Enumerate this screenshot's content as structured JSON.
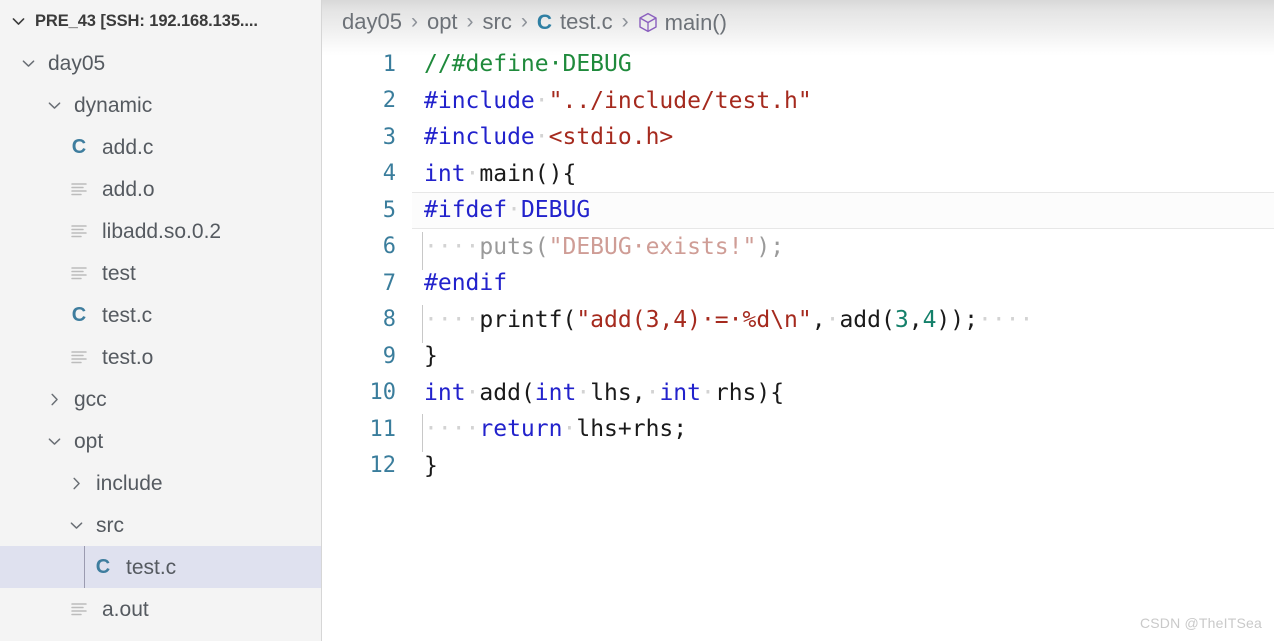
{
  "sidebar": {
    "header": {
      "label": "PRE_43 [SSH: 192.168.135....",
      "chevron": "chevron-down-icon"
    },
    "items": [
      {
        "label": "day05",
        "depth": 1,
        "kind": "folder",
        "state": "expanded",
        "icon": "chevron-down-icon",
        "selected": false
      },
      {
        "label": "dynamic",
        "depth": 2,
        "kind": "folder",
        "state": "expanded",
        "icon": "chevron-down-icon",
        "selected": false
      },
      {
        "label": "add.c",
        "depth": 3,
        "kind": "c-file",
        "state": "",
        "icon": "c-file-icon",
        "selected": false
      },
      {
        "label": "add.o",
        "depth": 3,
        "kind": "file",
        "state": "",
        "icon": "generic-file-icon",
        "selected": false
      },
      {
        "label": "libadd.so.0.2",
        "depth": 3,
        "kind": "file",
        "state": "",
        "icon": "generic-file-icon",
        "selected": false
      },
      {
        "label": "test",
        "depth": 3,
        "kind": "file",
        "state": "",
        "icon": "generic-file-icon",
        "selected": false
      },
      {
        "label": "test.c",
        "depth": 3,
        "kind": "c-file",
        "state": "",
        "icon": "c-file-icon",
        "selected": false
      },
      {
        "label": "test.o",
        "depth": 3,
        "kind": "file",
        "state": "",
        "icon": "generic-file-icon",
        "selected": false
      },
      {
        "label": "gcc",
        "depth": 2,
        "kind": "folder",
        "state": "collapsed",
        "icon": "chevron-right-icon",
        "selected": false
      },
      {
        "label": "opt",
        "depth": 2,
        "kind": "folder",
        "state": "expanded",
        "icon": "chevron-down-icon",
        "selected": false
      },
      {
        "label": "include",
        "depth": 3,
        "kind": "folder",
        "state": "collapsed",
        "icon": "chevron-right-icon",
        "selected": false
      },
      {
        "label": "src",
        "depth": 3,
        "kind": "folder",
        "state": "expanded",
        "icon": "chevron-down-icon",
        "selected": false
      },
      {
        "label": "test.c",
        "depth": 4,
        "kind": "c-file",
        "state": "",
        "icon": "c-file-icon",
        "selected": true
      },
      {
        "label": "a.out",
        "depth": 3,
        "kind": "file",
        "state": "",
        "icon": "generic-file-icon",
        "selected": false
      }
    ]
  },
  "breadcrumb": {
    "separator": "›",
    "crumbs": [
      {
        "label": "day05",
        "icon": ""
      },
      {
        "label": "opt",
        "icon": ""
      },
      {
        "label": "src",
        "icon": ""
      },
      {
        "label": "test.c",
        "icon": "c-file-icon"
      },
      {
        "label": "main()",
        "icon": "symbol-cube-icon"
      }
    ]
  },
  "editor": {
    "file": "test.c",
    "language": "C",
    "highlighted_line": 5,
    "lines": [
      {
        "n": "1",
        "indent_guide": false,
        "tokens": [
          {
            "t": "//#define·DEBUG",
            "c": "comment"
          }
        ]
      },
      {
        "n": "2",
        "indent_guide": false,
        "tokens": [
          {
            "t": "#include",
            "c": "pre"
          },
          {
            "t": "·",
            "c": "ws"
          },
          {
            "t": "\"../include/test.h\"",
            "c": "str"
          }
        ]
      },
      {
        "n": "3",
        "indent_guide": false,
        "tokens": [
          {
            "t": "#include",
            "c": "pre"
          },
          {
            "t": "·",
            "c": "ws"
          },
          {
            "t": "<stdio.h>",
            "c": "str"
          }
        ]
      },
      {
        "n": "4",
        "indent_guide": false,
        "tokens": [
          {
            "t": "int",
            "c": "kw"
          },
          {
            "t": "·",
            "c": "ws"
          },
          {
            "t": "main(){",
            "c": "plain"
          }
        ]
      },
      {
        "n": "5",
        "indent_guide": false,
        "tokens": [
          {
            "t": "#ifdef",
            "c": "pre"
          },
          {
            "t": "·",
            "c": "ws"
          },
          {
            "t": "DEBUG",
            "c": "pre"
          }
        ]
      },
      {
        "n": "6",
        "indent_guide": true,
        "tokens": [
          {
            "t": "····",
            "c": "ws"
          },
          {
            "t": "puts(",
            "c": "dim"
          },
          {
            "t": "\"DEBUG·exists!\"",
            "c": "dimstr"
          },
          {
            "t": ");",
            "c": "dim"
          }
        ]
      },
      {
        "n": "7",
        "indent_guide": false,
        "tokens": [
          {
            "t": "#endif",
            "c": "pre"
          }
        ]
      },
      {
        "n": "8",
        "indent_guide": true,
        "tokens": [
          {
            "t": "····",
            "c": "ws"
          },
          {
            "t": "printf(",
            "c": "plain"
          },
          {
            "t": "\"add(3,4)·=·%d\\n\"",
            "c": "str"
          },
          {
            "t": ",",
            "c": "plain"
          },
          {
            "t": "·",
            "c": "ws"
          },
          {
            "t": "add(",
            "c": "plain"
          },
          {
            "t": "3",
            "c": "num"
          },
          {
            "t": ",",
            "c": "plain"
          },
          {
            "t": "4",
            "c": "num"
          },
          {
            "t": "));",
            "c": "plain"
          },
          {
            "t": "····",
            "c": "ws"
          }
        ]
      },
      {
        "n": "9",
        "indent_guide": false,
        "tokens": [
          {
            "t": "}",
            "c": "plain"
          }
        ]
      },
      {
        "n": "10",
        "indent_guide": false,
        "tokens": [
          {
            "t": "int",
            "c": "kw"
          },
          {
            "t": "·",
            "c": "ws"
          },
          {
            "t": "add(",
            "c": "plain"
          },
          {
            "t": "int",
            "c": "kw"
          },
          {
            "t": "·",
            "c": "ws"
          },
          {
            "t": "lhs,",
            "c": "plain"
          },
          {
            "t": "·",
            "c": "ws"
          },
          {
            "t": "int",
            "c": "kw"
          },
          {
            "t": "·",
            "c": "ws"
          },
          {
            "t": "rhs){",
            "c": "plain"
          }
        ]
      },
      {
        "n": "11",
        "indent_guide": true,
        "tokens": [
          {
            "t": "····",
            "c": "ws"
          },
          {
            "t": "return",
            "c": "kw"
          },
          {
            "t": "·",
            "c": "ws"
          },
          {
            "t": "lhs+rhs;",
            "c": "plain"
          }
        ]
      },
      {
        "n": "12",
        "indent_guide": false,
        "tokens": [
          {
            "t": "}",
            "c": "plain"
          }
        ]
      }
    ]
  },
  "watermark": {
    "text": "CSDN @TheITSea"
  },
  "colors": {
    "sidebar_bg": "#f4f4f4",
    "selected_row_bg": "#dfe1ef",
    "editor_bg": "#ffffff",
    "line_number": "#3a7d9c",
    "comment": "#1f8a3c",
    "preprocessor": "#2222cc",
    "keyword": "#2222cc",
    "string": "#a52a1e",
    "number": "#14806a",
    "plain": "#1a1a1a",
    "dimmed": "#9a9a9a",
    "c_icon": "#3e7d9e",
    "symbol_cube": "#8a5fbe"
  }
}
